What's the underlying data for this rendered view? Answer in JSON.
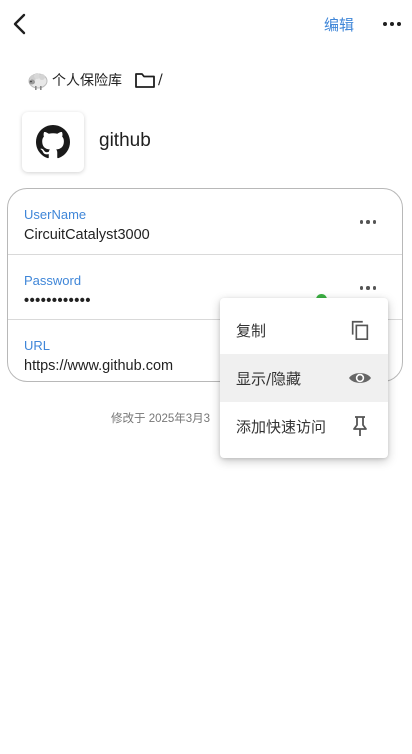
{
  "topbar": {
    "edit_label": "编辑"
  },
  "breadcrumb": {
    "vault_name": "个人保险库",
    "separator": "/"
  },
  "item": {
    "title": "github"
  },
  "fields": [
    {
      "label": "UserName",
      "value": "CircuitCatalyst3000"
    },
    {
      "label": "Password",
      "value": "••••••••••••",
      "strength_color": "#3cb043"
    },
    {
      "label": "URL",
      "value": "https://www.github.com"
    }
  ],
  "modified_text": "修改于 2025年3月3",
  "menu": {
    "items": [
      {
        "label": "复制",
        "icon": "copy-icon"
      },
      {
        "label": "显示/隐藏",
        "icon": "eye-icon"
      },
      {
        "label": "添加快速访问",
        "icon": "pin-icon"
      }
    ]
  },
  "colors": {
    "accent": "#3f86d8",
    "text": "#1f1f1f"
  }
}
